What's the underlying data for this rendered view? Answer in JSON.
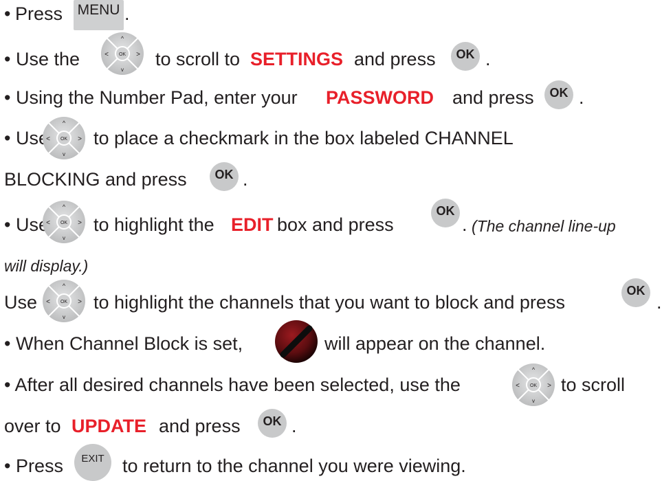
{
  "steps": {
    "s1": {
      "bullet": "•",
      "text_a": "Press",
      "end": "."
    },
    "s2": {
      "text_a": "• Use the",
      "text_b": "to scroll to",
      "emph": "SETTINGS",
      "text_c": "and press",
      "end": "."
    },
    "s3": {
      "text_a": "• Using the Number Pad, enter your",
      "emph": "PASSWORD",
      "text_b": "and press",
      "end": "."
    },
    "s4": {
      "text_a": "• Use",
      "text_b": "to place a checkmark in the box labeled CHANNEL",
      "text_c": "BLOCKING and press",
      "end": "."
    },
    "s5": {
      "text_a": "• Use",
      "text_b": "to highlight the",
      "emph": "EDIT",
      "text_c": "box and press",
      "end": ".",
      "note_a": "(The channel line-up",
      "note_b": "will display.)"
    },
    "s6": {
      "text_a": "Use",
      "text_b": "to highlight the channels that you want to block and press",
      "end": "."
    },
    "s7": {
      "text_a": "• When Channel Block is set,",
      "text_b": "will appear on the channel."
    },
    "s8": {
      "text_a": "• After all desired channels have been selected, use the",
      "text_b": "to scroll",
      "text_c": "over to",
      "emph": "UPDATE",
      "text_d": "and press",
      "end": "."
    },
    "s9": {
      "text_a": "• Press",
      "text_b": "to return to the channel you were viewing."
    }
  },
  "buttons": {
    "menu": "MENU",
    "ok": "OK",
    "exit": "EXIT",
    "nav_ok": "OK",
    "nav_up": "^",
    "nav_down": "v",
    "nav_left": "<",
    "nav_right": ">"
  },
  "colors": {
    "accent_red": "#e8202a",
    "button_gray": "#c8c9ca",
    "text": "#231f20"
  },
  "icons": {
    "nav": "directional-pad-icon",
    "block": "channel-block-icon"
  }
}
